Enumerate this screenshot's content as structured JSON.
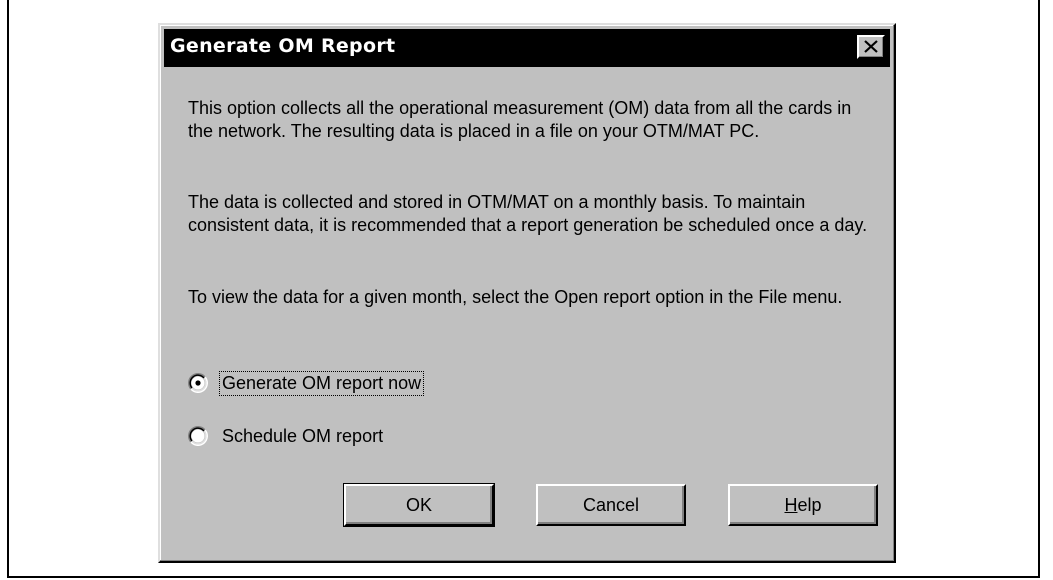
{
  "dialog": {
    "title": "Generate OM Report",
    "paragraphs": [
      "This option collects all the operational measurement (OM) data from all the cards in the network.  The resulting data is placed in a file on your OTM/MAT PC.",
      "The data is collected and stored in OTM/MAT on a monthly basis.  To maintain consistent data, it is recommended that a report generation be scheduled once a day.",
      "To view the data for a given month, select the Open report option in the File menu."
    ],
    "options": [
      {
        "label": "Generate OM report now",
        "selected": true
      },
      {
        "label": "Schedule OM report",
        "selected": false
      }
    ],
    "buttons": {
      "ok": "OK",
      "cancel": "Cancel",
      "help_mnemonic": "H",
      "help_rest": "elp"
    },
    "icons": {
      "close": "close-icon",
      "radio_selected": "radio-selected-icon",
      "radio_unselected": "radio-unselected-icon"
    }
  }
}
